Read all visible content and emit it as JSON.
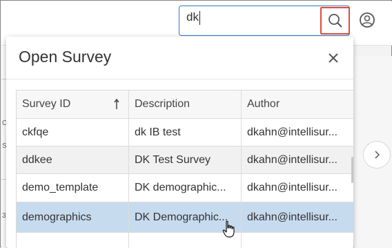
{
  "search": {
    "value": "dk"
  },
  "icons": {
    "search": "search-icon",
    "account": "account-circle-icon",
    "close": "close-icon",
    "next": "chevron-right-icon",
    "sort": "sort-ascending-arrow-icon",
    "cursor": "hand-pointer-cursor"
  },
  "dialog": {
    "title": "Open Survey",
    "columns": [
      "Survey ID",
      "Description",
      "Author"
    ],
    "rows": [
      {
        "id": "ckfqe",
        "description": "dk IB test",
        "author": "dkahn@intellisur..."
      },
      {
        "id": "ddkee",
        "description": "DK Test Survey",
        "author": "dkahn@intellisur..."
      },
      {
        "id": "demo_template",
        "description": "DK demographic...",
        "author": "dkahn@intellisur..."
      },
      {
        "id": "demographics",
        "description": "DK Demographic...",
        "author": "dkahn@intellisur..."
      }
    ]
  },
  "background": {
    "left_chars": [
      "C",
      "S",
      "3"
    ]
  },
  "colors": {
    "search_border": "#2f78c4",
    "search_button_highlight": "#e14a3c",
    "selected_row": "#c7dbef"
  }
}
